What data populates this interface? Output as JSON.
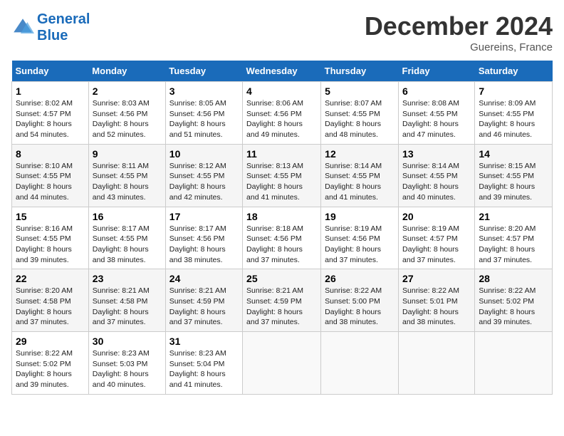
{
  "header": {
    "logo_line1": "General",
    "logo_line2": "Blue",
    "month": "December 2024",
    "location": "Guereins, France"
  },
  "days_of_week": [
    "Sunday",
    "Monday",
    "Tuesday",
    "Wednesday",
    "Thursday",
    "Friday",
    "Saturday"
  ],
  "weeks": [
    [
      {
        "day": "1",
        "sunrise": "8:02 AM",
        "sunset": "4:57 PM",
        "daylight": "8 hours and 54 minutes."
      },
      {
        "day": "2",
        "sunrise": "8:03 AM",
        "sunset": "4:56 PM",
        "daylight": "8 hours and 52 minutes."
      },
      {
        "day": "3",
        "sunrise": "8:05 AM",
        "sunset": "4:56 PM",
        "daylight": "8 hours and 51 minutes."
      },
      {
        "day": "4",
        "sunrise": "8:06 AM",
        "sunset": "4:56 PM",
        "daylight": "8 hours and 49 minutes."
      },
      {
        "day": "5",
        "sunrise": "8:07 AM",
        "sunset": "4:55 PM",
        "daylight": "8 hours and 48 minutes."
      },
      {
        "day": "6",
        "sunrise": "8:08 AM",
        "sunset": "4:55 PM",
        "daylight": "8 hours and 47 minutes."
      },
      {
        "day": "7",
        "sunrise": "8:09 AM",
        "sunset": "4:55 PM",
        "daylight": "8 hours and 46 minutes."
      }
    ],
    [
      {
        "day": "8",
        "sunrise": "8:10 AM",
        "sunset": "4:55 PM",
        "daylight": "8 hours and 44 minutes."
      },
      {
        "day": "9",
        "sunrise": "8:11 AM",
        "sunset": "4:55 PM",
        "daylight": "8 hours and 43 minutes."
      },
      {
        "day": "10",
        "sunrise": "8:12 AM",
        "sunset": "4:55 PM",
        "daylight": "8 hours and 42 minutes."
      },
      {
        "day": "11",
        "sunrise": "8:13 AM",
        "sunset": "4:55 PM",
        "daylight": "8 hours and 41 minutes."
      },
      {
        "day": "12",
        "sunrise": "8:14 AM",
        "sunset": "4:55 PM",
        "daylight": "8 hours and 41 minutes."
      },
      {
        "day": "13",
        "sunrise": "8:14 AM",
        "sunset": "4:55 PM",
        "daylight": "8 hours and 40 minutes."
      },
      {
        "day": "14",
        "sunrise": "8:15 AM",
        "sunset": "4:55 PM",
        "daylight": "8 hours and 39 minutes."
      }
    ],
    [
      {
        "day": "15",
        "sunrise": "8:16 AM",
        "sunset": "4:55 PM",
        "daylight": "8 hours and 39 minutes."
      },
      {
        "day": "16",
        "sunrise": "8:17 AM",
        "sunset": "4:55 PM",
        "daylight": "8 hours and 38 minutes."
      },
      {
        "day": "17",
        "sunrise": "8:17 AM",
        "sunset": "4:56 PM",
        "daylight": "8 hours and 38 minutes."
      },
      {
        "day": "18",
        "sunrise": "8:18 AM",
        "sunset": "4:56 PM",
        "daylight": "8 hours and 37 minutes."
      },
      {
        "day": "19",
        "sunrise": "8:19 AM",
        "sunset": "4:56 PM",
        "daylight": "8 hours and 37 minutes."
      },
      {
        "day": "20",
        "sunrise": "8:19 AM",
        "sunset": "4:57 PM",
        "daylight": "8 hours and 37 minutes."
      },
      {
        "day": "21",
        "sunrise": "8:20 AM",
        "sunset": "4:57 PM",
        "daylight": "8 hours and 37 minutes."
      }
    ],
    [
      {
        "day": "22",
        "sunrise": "8:20 AM",
        "sunset": "4:58 PM",
        "daylight": "8 hours and 37 minutes."
      },
      {
        "day": "23",
        "sunrise": "8:21 AM",
        "sunset": "4:58 PM",
        "daylight": "8 hours and 37 minutes."
      },
      {
        "day": "24",
        "sunrise": "8:21 AM",
        "sunset": "4:59 PM",
        "daylight": "8 hours and 37 minutes."
      },
      {
        "day": "25",
        "sunrise": "8:21 AM",
        "sunset": "4:59 PM",
        "daylight": "8 hours and 37 minutes."
      },
      {
        "day": "26",
        "sunrise": "8:22 AM",
        "sunset": "5:00 PM",
        "daylight": "8 hours and 38 minutes."
      },
      {
        "day": "27",
        "sunrise": "8:22 AM",
        "sunset": "5:01 PM",
        "daylight": "8 hours and 38 minutes."
      },
      {
        "day": "28",
        "sunrise": "8:22 AM",
        "sunset": "5:02 PM",
        "daylight": "8 hours and 39 minutes."
      }
    ],
    [
      {
        "day": "29",
        "sunrise": "8:22 AM",
        "sunset": "5:02 PM",
        "daylight": "8 hours and 39 minutes."
      },
      {
        "day": "30",
        "sunrise": "8:23 AM",
        "sunset": "5:03 PM",
        "daylight": "8 hours and 40 minutes."
      },
      {
        "day": "31",
        "sunrise": "8:23 AM",
        "sunset": "5:04 PM",
        "daylight": "8 hours and 41 minutes."
      },
      null,
      null,
      null,
      null
    ]
  ]
}
